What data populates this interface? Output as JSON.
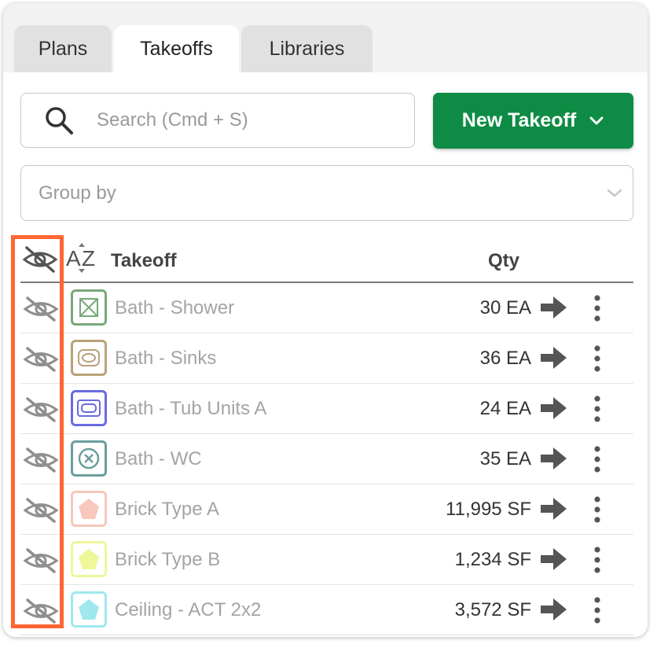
{
  "tabs": [
    {
      "label": "Plans",
      "active": false
    },
    {
      "label": "Takeoffs",
      "active": true
    },
    {
      "label": "Libraries",
      "active": false
    }
  ],
  "search": {
    "placeholder": "Search (Cmd + S)"
  },
  "new_takeoff": {
    "label": "New Takeoff"
  },
  "group_by": {
    "placeholder": "Group by"
  },
  "table": {
    "headers": {
      "takeoff": "Takeoff",
      "qty": "Qty"
    },
    "rows": [
      {
        "name": "Bath - Shower",
        "qty": "30 EA",
        "color": "#78a87a",
        "shape": "square-x",
        "icon": "shower-icon"
      },
      {
        "name": "Bath - Sinks",
        "qty": "36 EA",
        "color": "#b8a27a",
        "shape": "sink",
        "icon": "sink-icon"
      },
      {
        "name": "Bath - Tub Units A",
        "qty": "24 EA",
        "color": "#6a6ae0",
        "shape": "tub",
        "icon": "tub-icon"
      },
      {
        "name": "Bath - WC",
        "qty": "35 EA",
        "color": "#6a9e9e",
        "shape": "circle-x",
        "icon": "toilet-icon"
      },
      {
        "name": "Brick Type A",
        "qty": "11,995 SF",
        "color": "#f7c8bb",
        "shape": "pentagon",
        "icon": "pentagon-icon"
      },
      {
        "name": "Brick Type B",
        "qty": "1,234 SF",
        "color": "#eef79a",
        "shape": "pentagon",
        "icon": "pentagon-icon"
      },
      {
        "name": "Ceiling - ACT 2x2",
        "qty": "3,572 SF",
        "color": "#9ee8ee",
        "shape": "pentagon",
        "icon": "pentagon-icon"
      }
    ]
  },
  "colors": {
    "accent": "#0e8c45",
    "highlight": "#ff6633"
  }
}
